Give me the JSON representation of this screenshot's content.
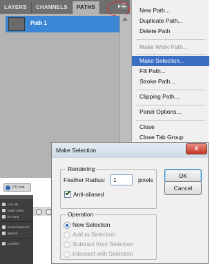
{
  "paths_panel": {
    "tabs": [
      "LAYERS",
      "CHANNELS",
      "PATHS"
    ],
    "active_tab": "PATHS",
    "paths": [
      {
        "name": "Path 1",
        "selected": true
      }
    ]
  },
  "flyout_menu": {
    "items": [
      {
        "label": "New Path...",
        "state": "normal"
      },
      {
        "label": "Duplicate Path...",
        "state": "normal"
      },
      {
        "label": "Delete Path",
        "state": "normal"
      },
      {
        "label": "Make Work Path...",
        "state": "disabled"
      },
      {
        "label": "Make Selection...",
        "state": "selected"
      },
      {
        "label": "Fill Path...",
        "state": "normal"
      },
      {
        "label": "Stroke Path...",
        "state": "normal"
      },
      {
        "label": "Clipping Path...",
        "state": "normal"
      },
      {
        "label": "Panel Options...",
        "state": "normal"
      },
      {
        "label": "Close",
        "state": "normal"
      },
      {
        "label": "Close Tab Group",
        "state": "normal"
      }
    ]
  },
  "dialog": {
    "title": "Make Selection",
    "close_glyph": "x",
    "rendering": {
      "legend": "Rendering",
      "feather_label": "Feather Radius:",
      "feather_value": "1",
      "feather_unit": "pixels",
      "antialiased_label": "Anti-aliased",
      "antialiased_checked": true
    },
    "operation": {
      "legend": "Operation",
      "options": [
        {
          "label": "New Selection",
          "checked": true,
          "enabled": true
        },
        {
          "label": "Add to Selection",
          "checked": false,
          "enabled": false
        },
        {
          "label": "Subtract from Selection",
          "checked": false,
          "enabled": false
        },
        {
          "label": "Intersect with Selection",
          "checked": false,
          "enabled": false
        }
      ]
    },
    "ok_label": "OK",
    "cancel_label": "Cancel"
  },
  "dock": {
    "cs_live_label": "CS Live",
    "items": [
      "COLOR",
      "SWATCHES",
      "STYLES",
      "ADJUSTMENTS",
      "MASKS",
      "LAYERS"
    ]
  },
  "colors": {
    "selection_blue": "#3b87d6",
    "menu_highlight": "#3b6fc4",
    "callout_red": "#d9262a"
  }
}
